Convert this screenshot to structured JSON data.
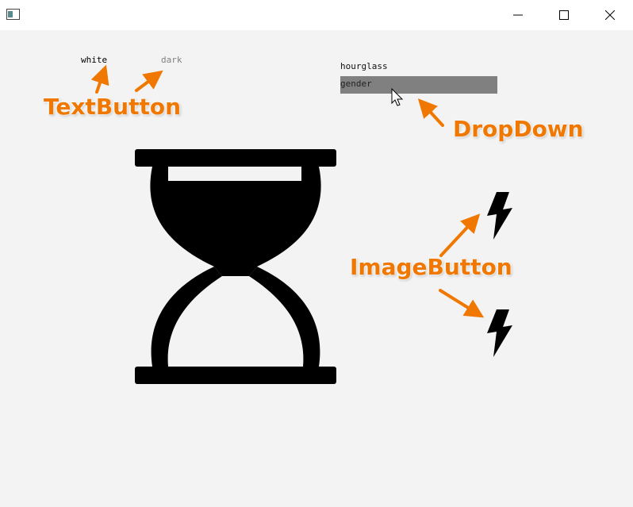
{
  "window": {
    "minimize_icon": "minimize-icon",
    "maximize_icon": "maximize-icon",
    "close_icon": "close-icon"
  },
  "text_buttons": [
    {
      "label": "white",
      "color": "#000000"
    },
    {
      "label": "dark",
      "color": "#808080"
    }
  ],
  "dropdown": {
    "items": [
      {
        "label": "hourglass",
        "selected": false
      },
      {
        "label": "gender",
        "selected": true
      }
    ],
    "selected_bg": "#808080"
  },
  "image": {
    "icon": "hourglass-icon"
  },
  "image_buttons": [
    {
      "icon": "lightning-icon"
    },
    {
      "icon": "lightning-icon"
    }
  ],
  "annotations": {
    "text_button": "TextButton",
    "dropdown": "DropDown",
    "image_button": "ImageButton"
  },
  "colors": {
    "annotation": "#f07800",
    "background": "#f3f3f3"
  }
}
